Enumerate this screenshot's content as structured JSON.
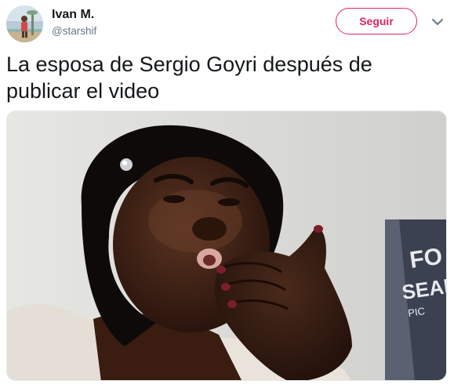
{
  "author": {
    "display_name": "Ivan M.",
    "handle": "@starshif",
    "avatar_icon": "profile-photo"
  },
  "follow": {
    "label": "Seguir"
  },
  "menu": {
    "icon": "chevron-down-icon"
  },
  "tweet": {
    "text": "La esposa de Sergio Goyri después de publicar el video"
  },
  "media": {
    "description_icon": "photo",
    "backdrop_letters": "FO SEAR PIC"
  },
  "colors": {
    "accent": "#e0245e",
    "text": "#14171a",
    "secondary": "#657786"
  }
}
